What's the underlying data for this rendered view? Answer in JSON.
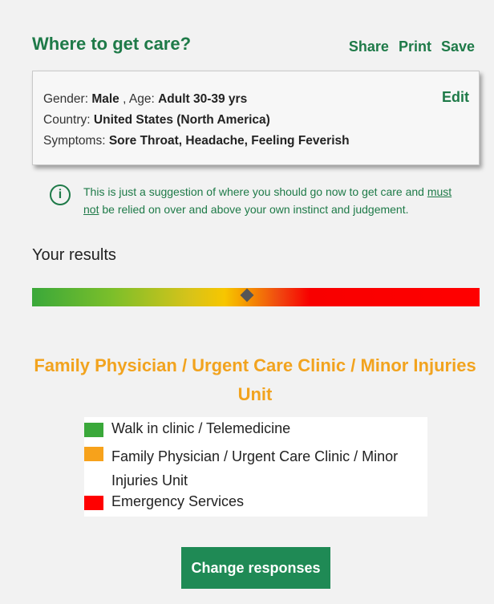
{
  "header": {
    "title": "Where to get care?",
    "actions": [
      "Share",
      "Print",
      "Save"
    ]
  },
  "summary": {
    "gender_label": "Gender:",
    "gender_value": "Male",
    "age_label": ", Age:",
    "age_value": "Adult 30-39 yrs",
    "country_label": "Country:",
    "country_value": "United States (North America)",
    "symptoms_label": "Symptoms:",
    "symptoms_value": "Sore Throat, Headache, Feeling Feverish",
    "edit_label": "Edit"
  },
  "notice": {
    "icon": "info-icon",
    "text_before": "This is just a suggestion of where you should go now to get care and ",
    "underlined": "must not",
    "text_after": " be relied on over and above your own instinct and judgement."
  },
  "results": {
    "label": "Your results",
    "scale_level_percent": 48,
    "recommendation": "Family Physician / Urgent Care Clinic / Minor Injuries Unit"
  },
  "legend": [
    {
      "label": "Walk in clinic / Telemedicine",
      "color": "#3aa83a"
    },
    {
      "label": "Family Physician / Urgent Care Clinic / Minor Injuries Unit",
      "color": "#f7a21b"
    },
    {
      "label": "Emergency Services",
      "color": "#ff0000"
    }
  ],
  "button": {
    "label": "Change responses"
  }
}
